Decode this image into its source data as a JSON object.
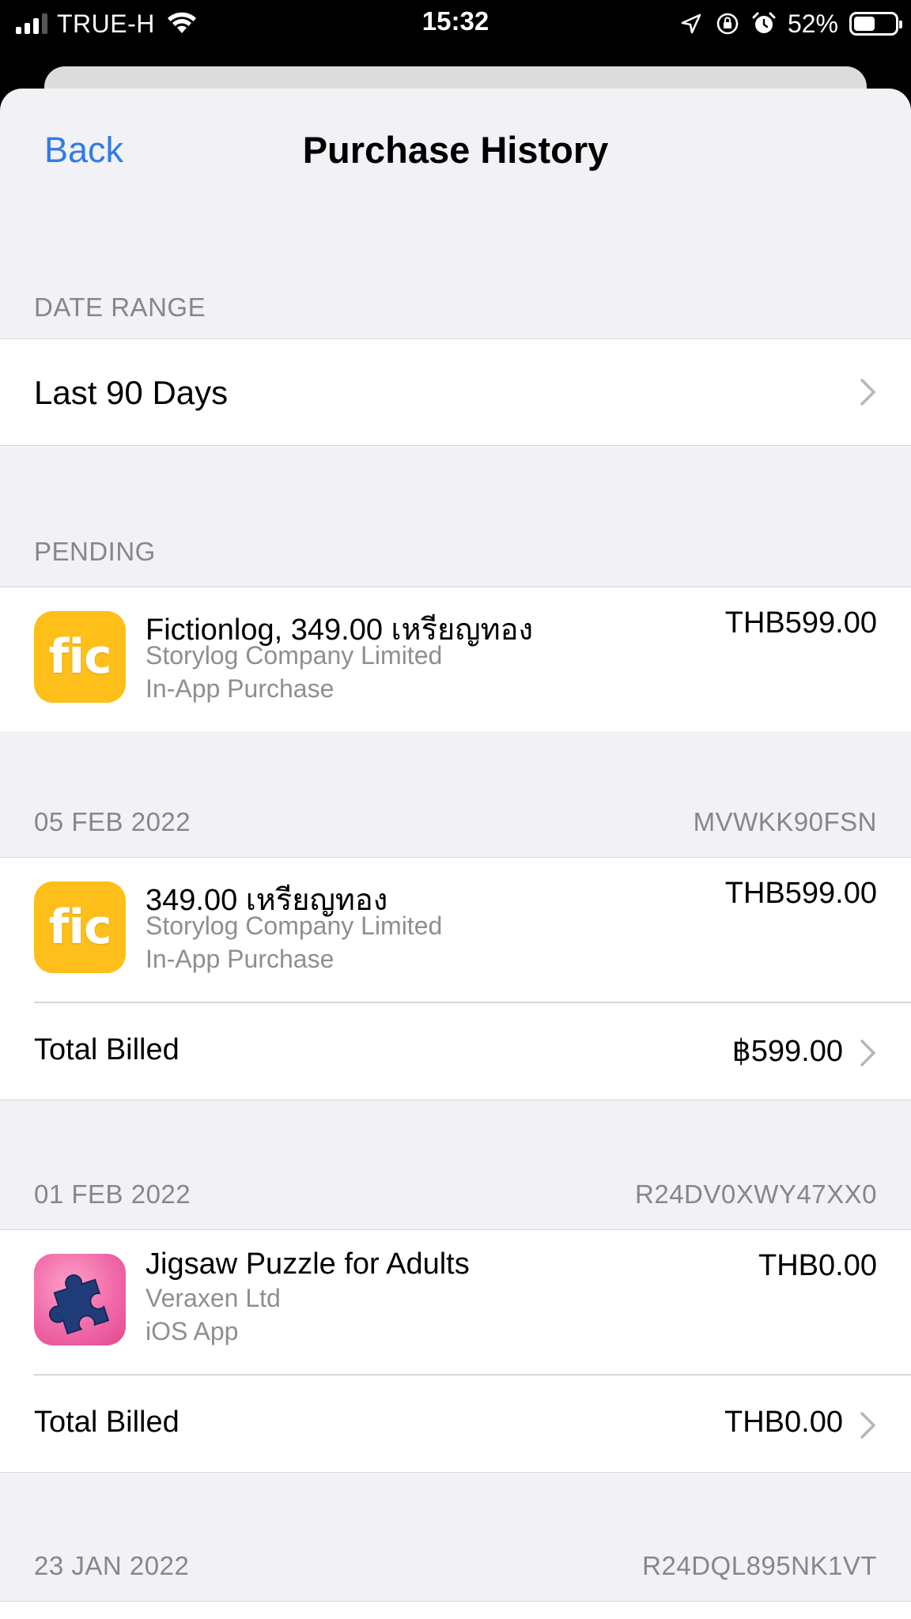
{
  "status_bar": {
    "carrier": "TRUE-H",
    "time": "15:32",
    "battery_percent": "52%",
    "battery_level": 0.52,
    "signal_bars": 3,
    "signal_bars_total": 4,
    "icons": [
      "signal-icon",
      "wifi-icon",
      "location-icon",
      "orientation-lock-icon",
      "alarm-icon",
      "battery-icon"
    ]
  },
  "nav": {
    "back_label": "Back",
    "title": "Purchase History"
  },
  "date_range": {
    "header": "DATE RANGE",
    "value": "Last 90 Days"
  },
  "pending": {
    "header": "PENDING",
    "item": {
      "icon_text": "fic",
      "name": "Fictionlog, 349.00 เหรียญทอง",
      "developer": "Storylog Company Limited",
      "type": "In-App Purchase",
      "price": "THB599.00"
    }
  },
  "orders": [
    {
      "date": "05 FEB 2022",
      "order_id": "MVWKK90FSN",
      "item": {
        "icon_text": "fic",
        "name": "349.00 เหรียญทอง",
        "developer": "Storylog Company Limited",
        "type": "In-App Purchase",
        "price": "THB599.00"
      },
      "total_label": "Total Billed",
      "total_amount": "฿599.00"
    },
    {
      "date": "01 FEB 2022",
      "order_id": "R24DV0XWY47XX0",
      "item": {
        "name": "Jigsaw Puzzle for Adults",
        "developer": "Veraxen Ltd",
        "type": "iOS App",
        "price": "THB0.00"
      },
      "total_label": "Total Billed",
      "total_amount": "THB0.00"
    },
    {
      "date": "23 JAN 2022",
      "order_id": "R24DQL895NK1VT"
    }
  ],
  "colors": {
    "accent": "#2f7ce6",
    "fic_icon": "#ffbf1a",
    "jigsaw_icon": "#f06aa8",
    "secondary_text": "#8e8e93",
    "grouped_background": "#f1f1f6"
  }
}
